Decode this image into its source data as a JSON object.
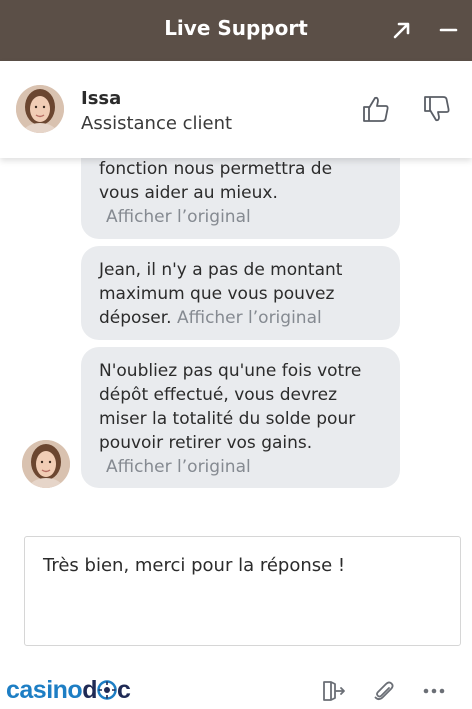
{
  "window": {
    "title": "Live Support",
    "expand_icon": "arrow-up-right-icon",
    "minimize_icon": "minus-icon"
  },
  "agent": {
    "name": "Issa",
    "role": "Assistance client",
    "rate_up_icon": "thumbs-up-icon",
    "rate_down_icon": "thumbs-down-icon"
  },
  "messages": [
    {
      "line1": "fonction nous permettra de",
      "line2": "vous aider au mieux.",
      "original_link": "Afficher l’original"
    },
    {
      "line1": "Jean, il n'y a pas de montant",
      "line2": "maximum que vous pouvez",
      "line3": "déposer.",
      "original_link": "Afficher l’original"
    },
    {
      "line1": "N'oubliez pas qu'une fois votre",
      "line2": "dépôt effectué, vous devrez",
      "line3": "miser la totalité du solde pour",
      "line4": "pouvoir retirer vos gains.",
      "original_link": "Afficher l’original"
    }
  ],
  "composer": {
    "value": "Très bien, merci pour la réponse !"
  },
  "footer": {
    "logo_part1": "casino",
    "logo_part2": "d",
    "logo_part3": "c",
    "exit_icon": "exit-door-icon",
    "attach_icon": "paperclip-icon",
    "more_icon": "more-dots-icon"
  },
  "colors": {
    "titlebar": "#5b4f47",
    "bubble": "#e9ebee",
    "link": "#858a91",
    "logo_blue": "#1d7ec4",
    "logo_navy": "#1f2a55"
  }
}
